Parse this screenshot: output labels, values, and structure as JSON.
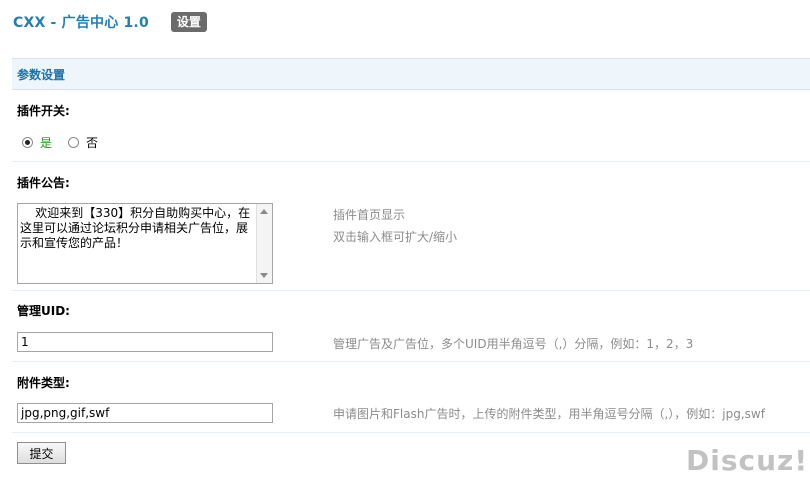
{
  "header": {
    "title": "CXX - 广告中心  1.0",
    "settings_tab": "设置"
  },
  "section": {
    "title": "参数设置"
  },
  "fields": {
    "plugin_switch": {
      "label": "插件开关:",
      "options": [
        {
          "label": "是",
          "checked": true
        },
        {
          "label": "否",
          "checked": false
        }
      ]
    },
    "plugin_notice": {
      "label": "插件公告:",
      "value": "    欢迎来到【330】积分自助购买中心，在这里可以通过论坛积分申请相关广告位，展示和宣传您的产品！",
      "hint_line1": "插件首页显示",
      "hint_line2": "双击输入框可扩大/缩小"
    },
    "admin_uid": {
      "label": "管理UID:",
      "value": "1",
      "hint": "管理广告及广告位，多个UID用半角逗号（,）分隔，例如：1，2，3"
    },
    "attachment_types": {
      "label": "附件类型:",
      "value": "jpg,png,gif,swf",
      "hint": "申请图片和Flash广告时，上传的附件类型，用半角逗号分隔（,），例如：jpg,swf"
    }
  },
  "submit_label": "提交",
  "watermark": "Discuz!"
}
